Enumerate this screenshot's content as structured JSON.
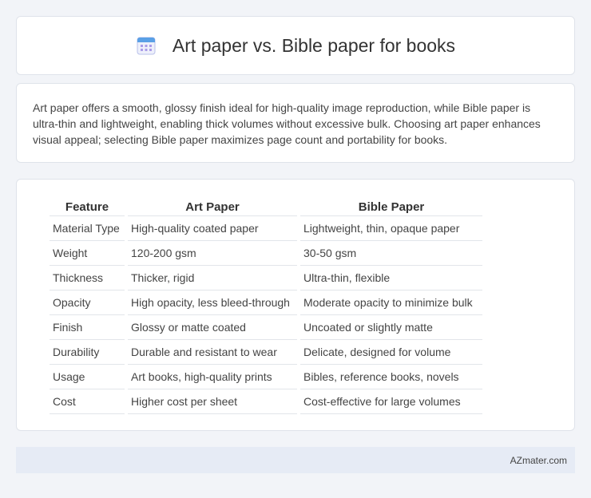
{
  "header": {
    "title": "Art paper vs. Bible paper for books",
    "icon": "calendar-icon"
  },
  "summary": {
    "text": "Art paper offers a smooth, glossy finish ideal for high-quality image reproduction, while Bible paper is ultra-thin and lightweight, enabling thick volumes without excessive bulk. Choosing art paper enhances visual appeal; selecting Bible paper maximizes page count and portability for books."
  },
  "table": {
    "headers": [
      "Feature",
      "Art Paper",
      "Bible Paper"
    ],
    "rows": [
      [
        "Material Type",
        "High-quality coated paper",
        "Lightweight, thin, opaque paper"
      ],
      [
        "Weight",
        "120-200 gsm",
        "30-50 gsm"
      ],
      [
        "Thickness",
        "Thicker, rigid",
        "Ultra-thin, flexible"
      ],
      [
        "Opacity",
        "High opacity, less bleed-through",
        "Moderate opacity to minimize bulk"
      ],
      [
        "Finish",
        "Glossy or matte coated",
        "Uncoated or slightly matte"
      ],
      [
        "Durability",
        "Durable and resistant to wear",
        "Delicate, designed for volume"
      ],
      [
        "Usage",
        "Art books, high-quality prints",
        "Bibles, reference books, novels"
      ],
      [
        "Cost",
        "Higher cost per sheet",
        "Cost-effective for large volumes"
      ]
    ]
  },
  "footer": {
    "brand": "AZmater.com"
  },
  "colors": {
    "accent": "#8a7fe0",
    "background": "#f2f4f8",
    "footer": "#e6ebf5"
  }
}
